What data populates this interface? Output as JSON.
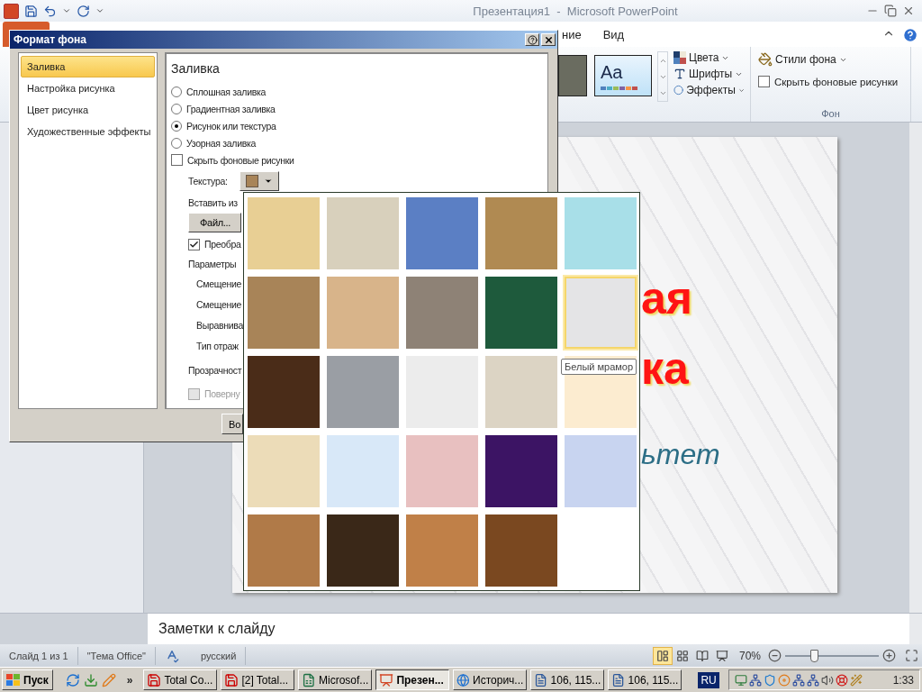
{
  "window": {
    "title": "Презентация1  -  Microsoft PowerPoint"
  },
  "ribbon": {
    "tabs": [
      {
        "label": "ние",
        "selected": false
      },
      {
        "label": "Вид",
        "selected": false
      }
    ],
    "theme_preview": "Aa",
    "theme_commands": [
      {
        "label": "Цвета",
        "kind": "colors"
      },
      {
        "label": "Шрифты",
        "kind": "fonts"
      },
      {
        "label": "Эффекты",
        "kind": "effects"
      }
    ],
    "background_styles": "Стили фона",
    "hide_graphics": {
      "label": "Скрыть фоновые рисунки",
      "checked": false
    },
    "group_label": "Фон"
  },
  "slide": {
    "lines": [
      {
        "text": "ая",
        "kind": "title"
      },
      {
        "text": "ка",
        "kind": "title"
      },
      {
        "text": "ьтет",
        "kind": "subtitle"
      }
    ]
  },
  "notes": {
    "placeholder": "Заметки к слайду"
  },
  "status_bar": {
    "slide": "Слайд 1 из 1",
    "theme": "\"Тема Office\"",
    "language": "русский",
    "zoom": "70%",
    "zoom_slider": {
      "level": 0.31
    }
  },
  "dialog": {
    "title": "Формат фона",
    "categories": [
      {
        "label": "Заливка",
        "selected": true
      },
      {
        "label": "Настройка рисунка",
        "selected": false
      },
      {
        "label": "Цвет рисунка",
        "selected": false
      },
      {
        "label": "Художественные эффекты",
        "selected": false
      }
    ],
    "heading": "Заливка",
    "fill_options": [
      {
        "label": "Сплошная заливка",
        "selected": false
      },
      {
        "label": "Градиентная заливка",
        "selected": false
      },
      {
        "label": "Рисунок или текстура",
        "selected": true
      },
      {
        "label": "Узорная заливка",
        "selected": false
      }
    ],
    "hide_graphics": {
      "label": "Скрыть фоновые рисунки",
      "checked": false
    },
    "texture_label": "Текстура:",
    "insert_from": "Вставить из",
    "file_button": "Файл...",
    "tile": {
      "label": "Преобра",
      "checked": true,
      "disabled": false
    },
    "params_label": "Параметры",
    "offsets": [
      "Смещение",
      "Смещение",
      "Выравнива",
      "Тип отраж"
    ],
    "transparency": "Прозрачност",
    "rotate": {
      "label": "Поверну",
      "checked": false,
      "disabled": true
    },
    "reset_button": "Во"
  },
  "gallery": {
    "textures": [
      {
        "color": "#e8cf94",
        "selected": false
      },
      {
        "color": "#d8d0bc",
        "selected": false
      },
      {
        "color": "#5b7fc4",
        "selected": false
      },
      {
        "color": "#b08a52",
        "selected": false
      },
      {
        "color": "#a8dfe8",
        "selected": false
      },
      {
        "color": "#a88458",
        "selected": false
      },
      {
        "color": "#d8b48a",
        "selected": false
      },
      {
        "color": "#8e8276",
        "selected": false
      },
      {
        "color": "#1e5a3c",
        "selected": false
      },
      {
        "color": "#e4e4e6",
        "selected": true
      },
      {
        "color": "#4a2c18",
        "selected": false
      },
      {
        "color": "#9a9ea4",
        "selected": false
      },
      {
        "color": "#ececec",
        "selected": false
      },
      {
        "color": "#dcd4c4",
        "selected": false
      },
      {
        "color": "#fcecd0",
        "selected": false
      },
      {
        "color": "#ecdcb8",
        "selected": false
      },
      {
        "color": "#d8e8f8",
        "selected": false
      },
      {
        "color": "#e8c0c0",
        "selected": false
      },
      {
        "color": "#3c1464",
        "selected": false
      },
      {
        "color": "#c8d4f0",
        "selected": false
      },
      {
        "color": "#b07a48",
        "selected": false
      },
      {
        "color": "#3a2818",
        "selected": false
      },
      {
        "color": "#c08048",
        "selected": false
      },
      {
        "color": "#7a4820",
        "selected": false
      }
    ],
    "tooltip": "Белый мрамор"
  },
  "taskbar": {
    "start": "Пуск",
    "more": "»",
    "tasks": [
      {
        "label": "Total Co...",
        "kind": "disk",
        "selected": false
      },
      {
        "label": "[2] Total...",
        "kind": "disk",
        "selected": false
      },
      {
        "label": "Microsof...",
        "kind": "sheet",
        "selected": false
      },
      {
        "label": "Презен...",
        "kind": "slides",
        "selected": true
      },
      {
        "label": "Историч...",
        "kind": "browser",
        "selected": false
      },
      {
        "label": "106, 115...",
        "kind": "doc",
        "selected": false
      },
      {
        "label": "106, 115...",
        "kind": "doc",
        "selected": false
      }
    ],
    "language": "RU",
    "clock": "1:33"
  }
}
